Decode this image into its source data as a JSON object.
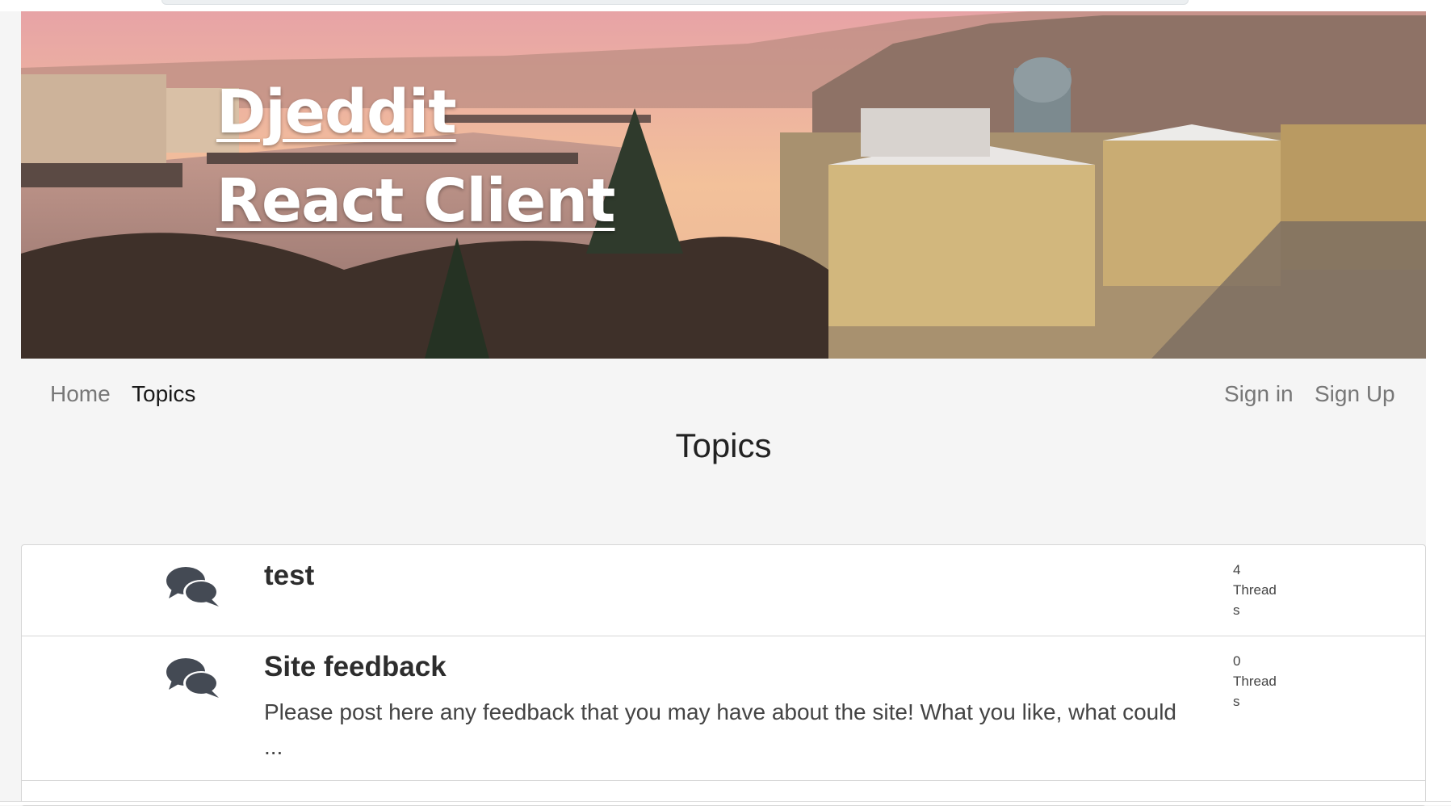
{
  "brand": {
    "line1": "Djeddit",
    "line2": "React Client"
  },
  "nav": {
    "home": "Home",
    "topics": "Topics",
    "sign_in": "Sign in",
    "sign_up": "Sign Up"
  },
  "page_title": "Topics",
  "topics": [
    {
      "title": "test",
      "description": "",
      "count": "4",
      "count_label": "Threads",
      "icon": "comments-icon"
    },
    {
      "title": "Site feedback",
      "description": "Please post here any feedback that you may have about the site! What you like, what could ...",
      "count": "0",
      "count_label": "Threads",
      "icon": "comments-icon"
    },
    {
      "title": "",
      "description": "",
      "count": "",
      "count_label": "",
      "icon": ""
    }
  ],
  "colors": {
    "background": "#f5f5f5",
    "nav_text": "#777777",
    "nav_active": "#1a1a1a",
    "icon": "#444a54"
  }
}
